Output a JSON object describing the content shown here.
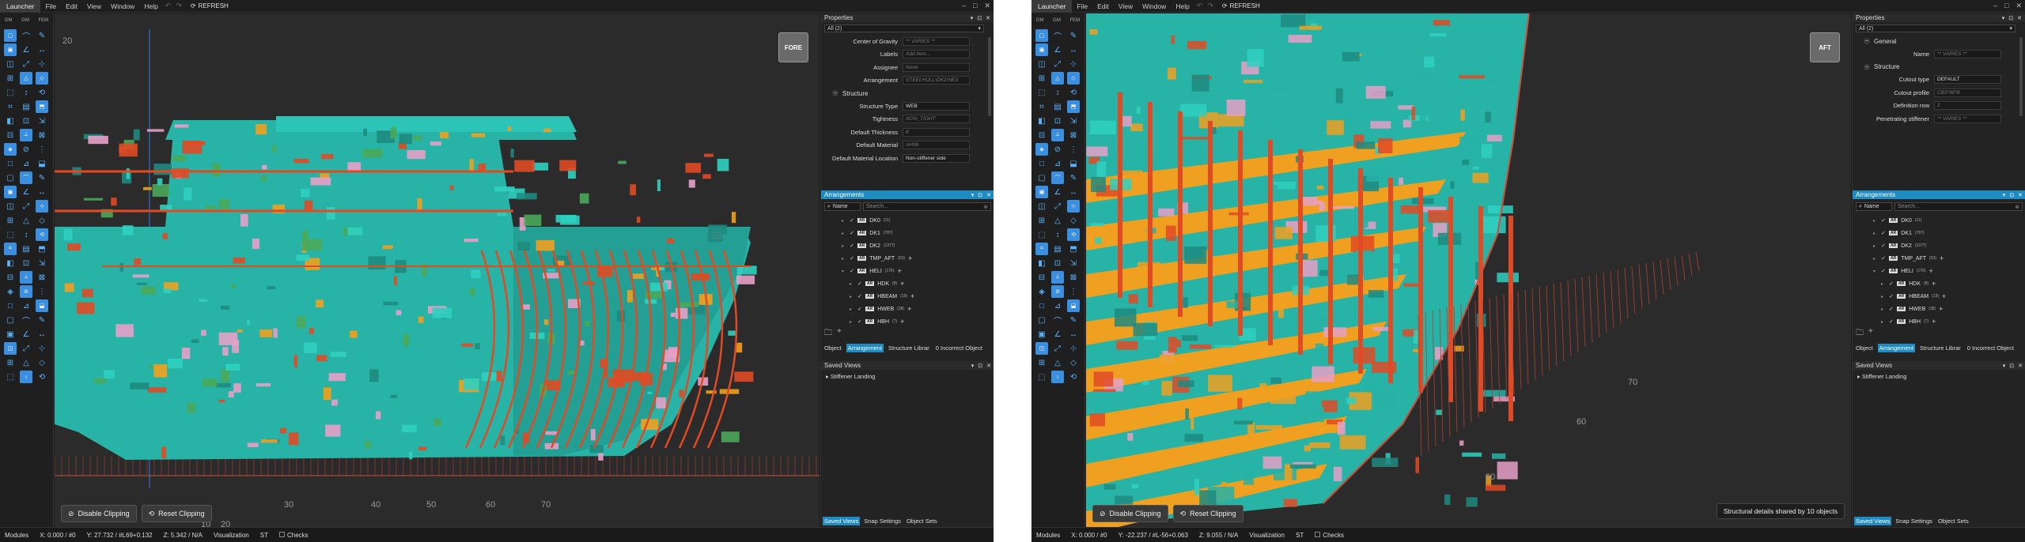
{
  "menu": {
    "launcher": "Launcher",
    "items": [
      "File",
      "Edit",
      "View",
      "Window",
      "Help"
    ],
    "refresh": "REFRESH"
  },
  "toolbar": {
    "headers": [
      "GM",
      "GM",
      "FEM"
    ]
  },
  "windows": [
    {
      "viewcube": "FORE",
      "axis_labels": {
        "top": "20",
        "bottom": [
          "10",
          "20",
          "30",
          "40",
          "50",
          "60",
          "70"
        ]
      },
      "clip": {
        "disable": "Disable Clipping",
        "reset": "Reset Clipping"
      },
      "toast": "",
      "properties": {
        "title": "Properties",
        "filter": "All (2)",
        "rows": [
          {
            "label": "Center of Gravity",
            "value": "** VARIES **",
            "kind": "ph"
          },
          {
            "label": "Labels",
            "value": "Add item...",
            "kind": "ph"
          },
          {
            "label": "Assignee",
            "value": "None",
            "kind": "ph"
          },
          {
            "label": "Arrangement",
            "value": "STEELHULL\\DK1\\NEX",
            "kind": "ph"
          }
        ],
        "section": "Structure",
        "rows2": [
          {
            "label": "Structure Type",
            "value": "WEB",
            "kind": "w"
          },
          {
            "label": "Tightness",
            "value": "NON_TIGHT",
            "kind": "ph"
          },
          {
            "label": "Default Thickness",
            "value": "8",
            "kind": "ph"
          },
          {
            "label": "Default Material",
            "value": "AH36",
            "kind": "ph"
          },
          {
            "label": "Default Material Location",
            "value": "Non-stiffener side",
            "kind": "w"
          }
        ]
      },
      "arrangements": {
        "title": "Arrangements",
        "filter": "Name",
        "search_placeholder": "Search...",
        "tree": [
          {
            "label": "DK0",
            "count": "(11)"
          },
          {
            "label": "DK1",
            "count": "(787)"
          },
          {
            "label": "DK2",
            "count": "(1377)"
          },
          {
            "label": "TMP_AFT",
            "count": "(53)"
          },
          {
            "label": "HELI",
            "count": "(176)"
          },
          {
            "label": "HDK",
            "count": "(8)"
          },
          {
            "label": "HBEAM",
            "count": "(19)"
          },
          {
            "label": "HWEB",
            "count": "(38)"
          },
          {
            "label": "HBH",
            "count": "(7)"
          }
        ],
        "tabs": [
          "Object",
          "Arrangement",
          "Structure Librar",
          "0 Incorrect Object"
        ]
      },
      "saved": {
        "title": "Saved Views",
        "items": [
          "Stiffener Landing"
        ],
        "tabs": [
          "Saved Views",
          "Snap Settings",
          "Object Sets"
        ]
      },
      "status": {
        "modules": "Modules",
        "x": "X: 0.000 / #0",
        "y": "Y: 27.732 / #L69+0.132",
        "z": "Z: 5.342 / N/A",
        "vis": "Visualization",
        "st": "ST",
        "checks": "Checks"
      }
    },
    {
      "viewcube": "AFT",
      "axis_labels": {
        "top": "",
        "bottom": [
          "50",
          "60",
          "70"
        ]
      },
      "clip": {
        "disable": "Disable Clipping",
        "reset": "Reset Clipping"
      },
      "toast": "Structural details shared by 10 objects",
      "properties": {
        "title": "Properties",
        "filter": "All (2)",
        "section0": "General",
        "rows": [
          {
            "label": "Name",
            "value": "** VARIES **",
            "kind": "ph"
          }
        ],
        "section": "Structure",
        "rows2": [
          {
            "label": "Cutout type",
            "value": "DEFAULT",
            "kind": "w"
          },
          {
            "label": "Cutout profile",
            "value": "CB3*80*8",
            "kind": "ph"
          },
          {
            "label": "Definition row",
            "value": "1",
            "kind": "ph"
          },
          {
            "label": "Penetrating stiffener",
            "value": "** VARIES **",
            "kind": "ph"
          }
        ]
      },
      "arrangements": {
        "title": "Arrangements",
        "filter": "Name",
        "search_placeholder": "Search...",
        "tree": [
          {
            "label": "DK0",
            "count": "(11)"
          },
          {
            "label": "DK1",
            "count": "(787)"
          },
          {
            "label": "DK2",
            "count": "(1377)"
          },
          {
            "label": "TMP_AFT",
            "count": "(53)"
          },
          {
            "label": "HELI",
            "count": "(176)"
          },
          {
            "label": "HDK",
            "count": "(8)"
          },
          {
            "label": "HBEAM",
            "count": "(19)"
          },
          {
            "label": "HWEB",
            "count": "(38)"
          },
          {
            "label": "HBH",
            "count": "(7)"
          }
        ],
        "tabs": [
          "Object",
          "Arrangement",
          "Structure Librar",
          "0 Incorrect Object"
        ]
      },
      "saved": {
        "title": "Saved Views",
        "items": [
          "Stiffener Landing"
        ],
        "tabs": [
          "Saved Views",
          "Snap Settings",
          "Object Sets"
        ]
      },
      "status": {
        "modules": "Modules",
        "x": "X: 0.000 / #0",
        "y": "Y: -22.237 / #L-56+0.063",
        "z": "Z: 9.055 / N/A",
        "vis": "Visualization",
        "st": "ST",
        "checks": "Checks"
      }
    }
  ],
  "colors": {
    "teal": "#27b3a6",
    "orange": "#f0a020",
    "red": "#e04a25",
    "pink": "#e8a0c8",
    "green": "#4aa85a",
    "accent": "#1e8bc3"
  }
}
